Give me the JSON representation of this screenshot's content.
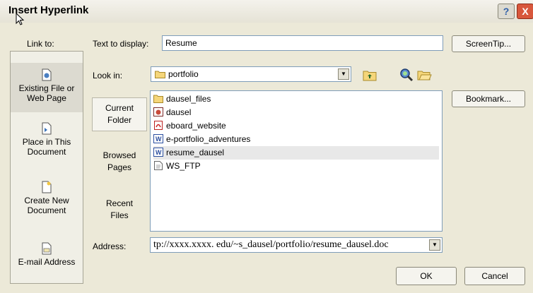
{
  "dialog": {
    "title": "Insert Hyperlink",
    "help_button": "?",
    "close_button": "X"
  },
  "link_to": {
    "label": "Link to:",
    "items": [
      {
        "line1": "Existing File or",
        "line2": "Web Page",
        "icon": "existing-file-icon",
        "selected": true
      },
      {
        "line1": "Place in This",
        "line2": "Document",
        "icon": "place-in-document-icon",
        "selected": false
      },
      {
        "line1": "Create New",
        "line2": "Document",
        "icon": "create-new-document-icon",
        "selected": false
      },
      {
        "line1": "E-mail Address",
        "line2": "",
        "icon": "email-address-icon",
        "selected": false
      }
    ]
  },
  "text_to_display": {
    "label": "Text to display:",
    "value": "Resume"
  },
  "screentip_button": "ScreenTip...",
  "look_in": {
    "label": "Look in:",
    "value": "portfolio"
  },
  "bookmark_button": "Bookmark...",
  "side_nav": [
    {
      "line1": "Current",
      "line2": "Folder",
      "selected": true
    },
    {
      "line1": "Browsed",
      "line2": "Pages",
      "selected": false
    },
    {
      "line1": "Recent",
      "line2": "Files",
      "selected": false
    }
  ],
  "files": [
    {
      "name": "dausel_files",
      "icon": "folder-icon",
      "selected": false
    },
    {
      "name": "dausel",
      "icon": "web-page-icon",
      "selected": false
    },
    {
      "name": "eboard_website",
      "icon": "pdf-icon",
      "selected": false
    },
    {
      "name": "e-portfolio_adventures",
      "icon": "word-document-icon",
      "selected": false
    },
    {
      "name": "resume_dausel",
      "icon": "word-document-icon",
      "selected": true
    },
    {
      "name": "WS_FTP",
      "icon": "text-file-icon",
      "selected": false
    }
  ],
  "address": {
    "label": "Address:",
    "value": "tp://xxxx.xxxx. edu/~s_dausel/portfolio/resume_dausel.doc"
  },
  "ok_button": "OK",
  "cancel_button": "Cancel",
  "colors": {
    "dialog_bg": "#ece9d8",
    "close_red": "#d8573c",
    "input_border": "#7f9db9"
  }
}
